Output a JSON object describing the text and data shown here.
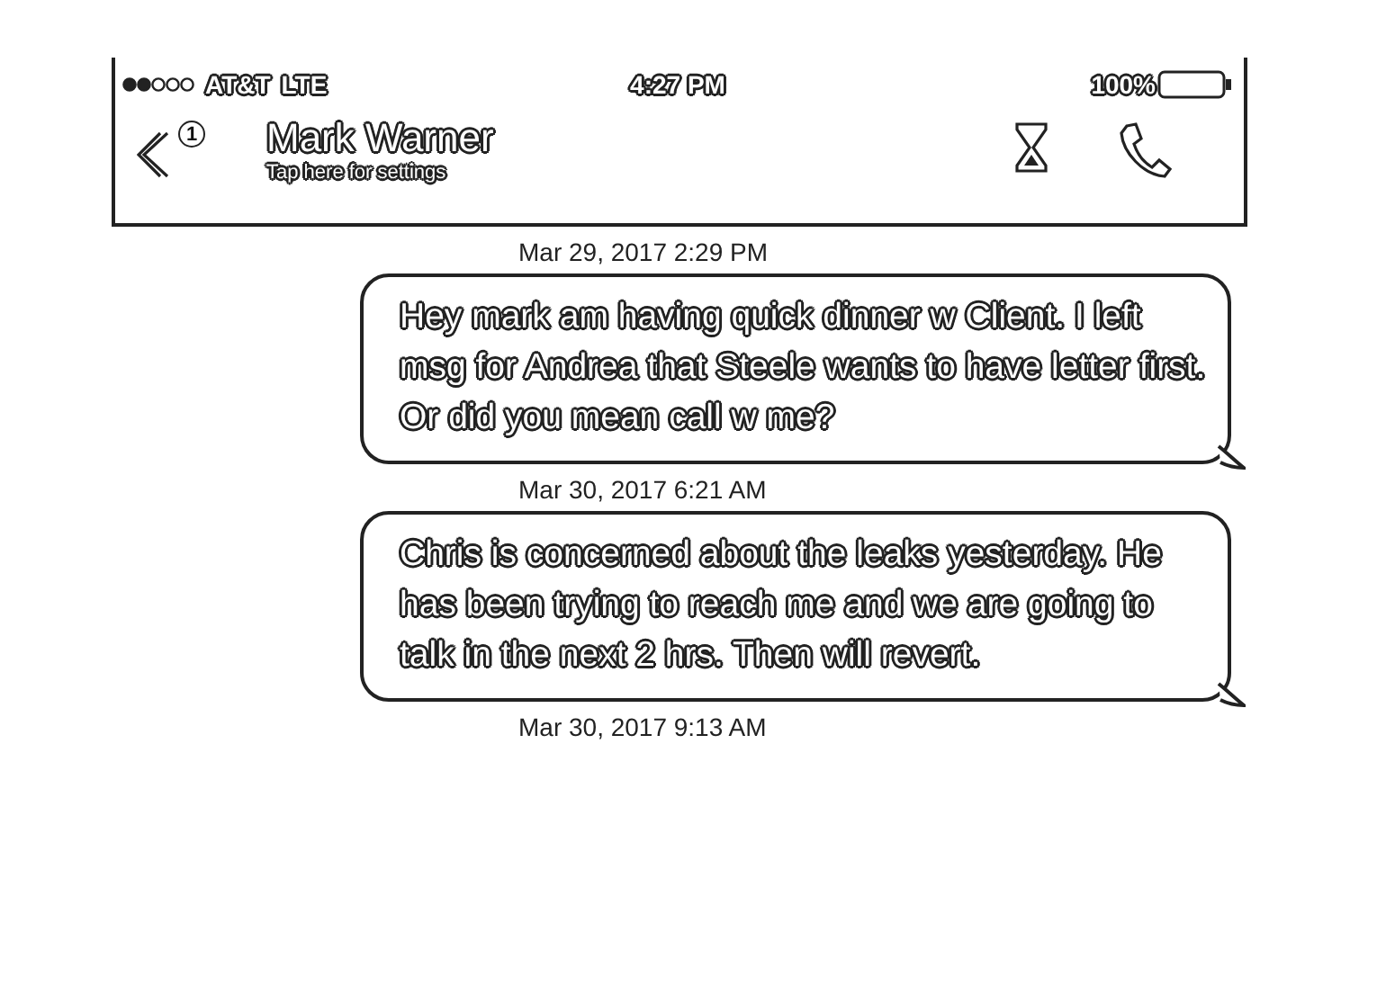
{
  "status_bar": {
    "carrier": "AT&T",
    "network": "LTE",
    "time": "4:27 PM",
    "battery": "100%"
  },
  "header": {
    "unread_count": "1",
    "contact_name": "Mark Warner",
    "subtitle": "Tap here for settings"
  },
  "messages": [
    {
      "timestamp": "Mar 29, 2017 2:29 PM",
      "text": "Hey mark am having quick dinner w Client. I left msg for Andrea that Steele wants to have letter first. Or did you mean call w me?"
    },
    {
      "timestamp": "Mar 30, 2017 6:21 AM",
      "text": "Chris is concerned about the leaks yesterday. He has been trying to reach me and we are going to talk in the next 2 hrs. Then will revert."
    },
    {
      "timestamp": "Mar 30, 2017 9:13 AM"
    }
  ]
}
